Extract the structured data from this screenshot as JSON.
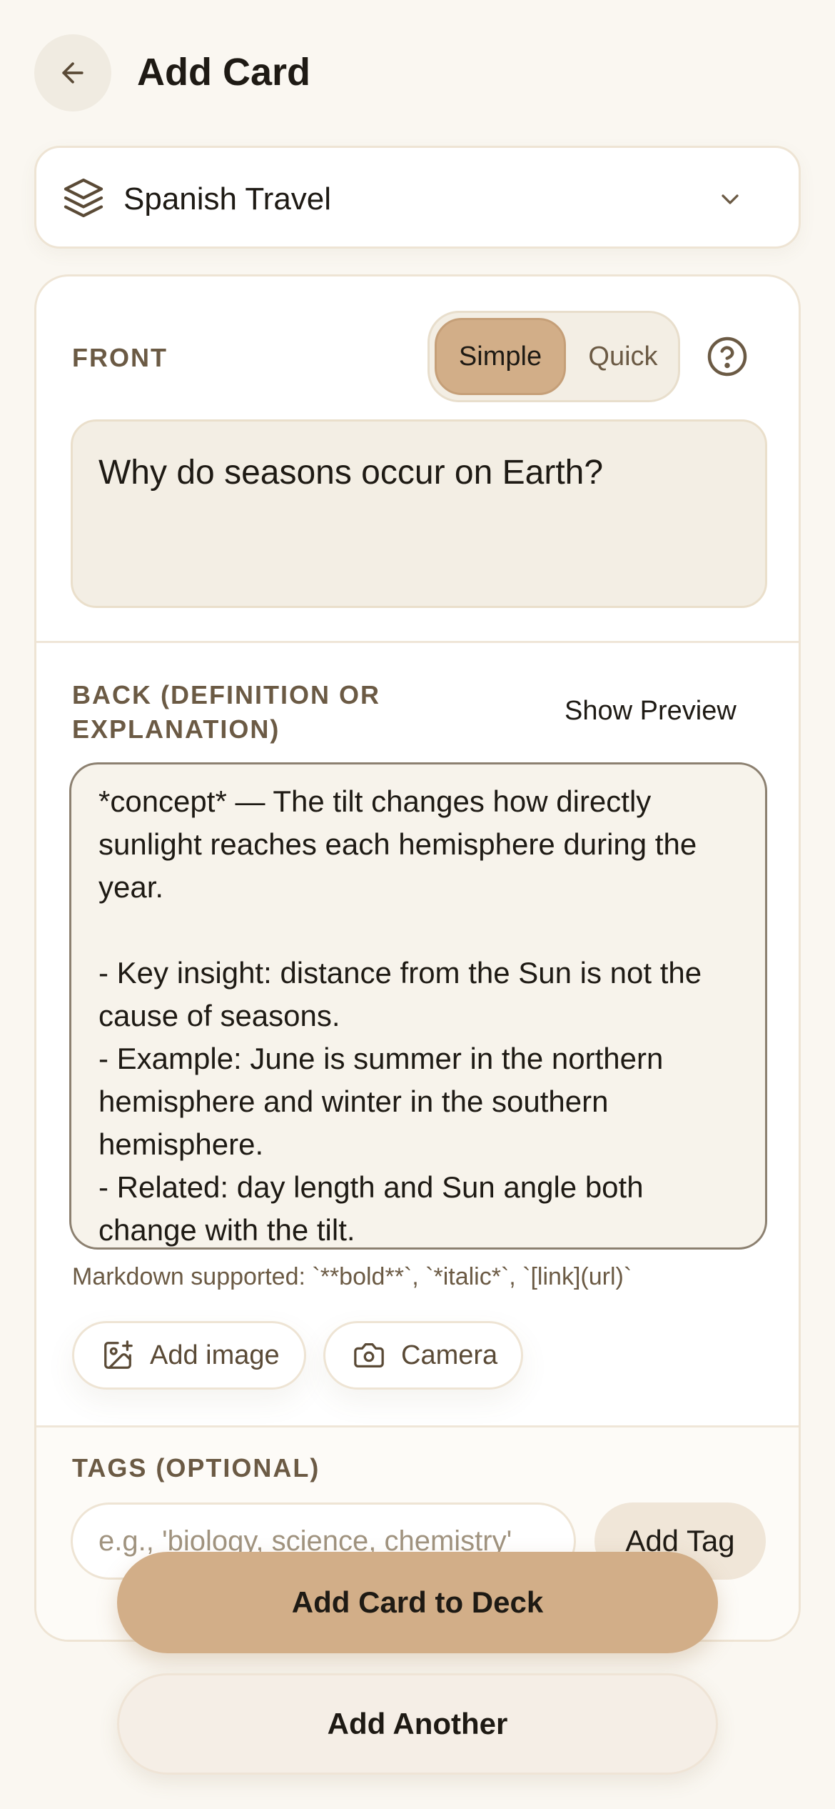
{
  "header": {
    "title": "Add Card",
    "back_icon": "arrow-left-icon"
  },
  "deck": {
    "selected": "Spanish Travel",
    "icon": "layers-icon",
    "chevron_icon": "chevron-down-icon"
  },
  "front": {
    "label": "FRONT",
    "modes": [
      "Simple",
      "Quick"
    ],
    "active_mode": "Simple",
    "help_icon": "help-circle-icon",
    "value": "Why do seasons occur on Earth?"
  },
  "back": {
    "label_line1": "BACK (DEFINITION OR",
    "label_line2": "EXPLANATION)",
    "show_preview": "Show Preview",
    "value": "*concept* — The tilt changes how directly sunlight reaches each hemisphere during the year.\n\n- Key insight: distance from the Sun is not the cause of seasons.\n- Example: June is summer in the northern hemisphere and winter in the southern hemisphere.\n- Related: day length and Sun angle both change with the tilt.",
    "markdown_hint": "Markdown supported: `**bold**`, `*italic*`, `[link](url)`",
    "add_image": "Add image",
    "camera": "Camera"
  },
  "tags": {
    "label": "TAGS (OPTIONAL)",
    "placeholder": "e.g., 'biology, science, chemistry'",
    "add_tag": "Add Tag"
  },
  "actions": {
    "primary": "Add Card to Deck",
    "secondary": "Add Another"
  },
  "colors": {
    "background": "#FAF7F1",
    "accent": "#D2AE88",
    "text": "#1E1A14",
    "muted": "#6B5A44"
  }
}
